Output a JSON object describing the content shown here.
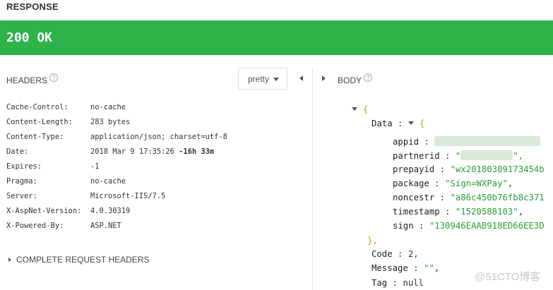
{
  "title": "RESPONSE",
  "status": "200 OK",
  "headers_label": "HEADERS",
  "body_label": "BODY",
  "help_glyph": "?",
  "format_button": "pretty",
  "headers": [
    {
      "name": "Cache-Control:",
      "value": "no-cache",
      "extra": ""
    },
    {
      "name": "Content-Length:",
      "value": "283 bytes",
      "extra": ""
    },
    {
      "name": "Content-Type:",
      "value": "application/json; charset=utf-8",
      "extra": ""
    },
    {
      "name": "Date:",
      "value": "2018 Mar 9 17:35:26 ",
      "extra": "-16h 33m"
    },
    {
      "name": "Expires:",
      "value": "-1",
      "extra": ""
    },
    {
      "name": "Pragma:",
      "value": "no-cache",
      "extra": ""
    },
    {
      "name": "Server:",
      "value": "Microsoft-IIS/7.5",
      "extra": ""
    },
    {
      "name": "X-AspNet-Version:",
      "value": "4.0.30319",
      "extra": ""
    },
    {
      "name": "X-Powered-By:",
      "value": "ASP.NET",
      "extra": ""
    }
  ],
  "complete_headers_label": "COMPLETE REQUEST HEADERS",
  "json_body": {
    "open_brace": "{",
    "close_brace": "}",
    "data_key": "Data",
    "data_close": "},",
    "appid_key": "appid",
    "partnerid_key": "partnerid",
    "prepayid_key": "prepayid",
    "prepayid_val": "\"wx20180309173454b",
    "package_key": "package",
    "package_val": "\"Sign=WXPay\"",
    "noncestr_key": "noncestr",
    "noncestr_val": "\"a86c450b76fb8c371",
    "timestamp_key": "timestamp",
    "timestamp_val": "\"1520588103\"",
    "sign_key": "sign",
    "sign_val": "\"130946EAAB918ED66EE3D",
    "code_key": "Code",
    "code_val": "2",
    "message_key": "Message",
    "message_val": "\"\"",
    "tag_key": "Tag",
    "tag_val": "null"
  },
  "watermark": "@51CTO博客",
  "colors": {
    "status_bg": "#2db34a",
    "string": "#2a9d3a",
    "brace": "#c8a000"
  },
  "icons": [
    "help-icon",
    "caret-down-icon",
    "collapse-left-icon",
    "expand-right-icon",
    "triangle-right-icon",
    "triangle-down-icon"
  ]
}
